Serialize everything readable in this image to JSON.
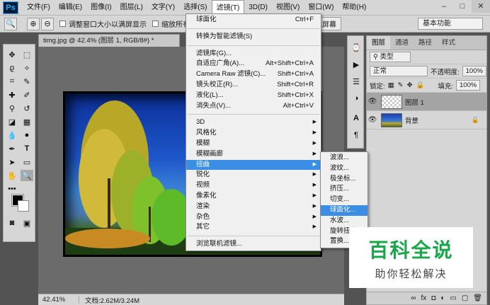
{
  "menubar": {
    "logo": "Ps",
    "items": [
      "文件(F)",
      "编辑(E)",
      "图像(I)",
      "图层(L)",
      "文字(Y)",
      "选择(S)",
      "滤镜(T)",
      "3D(D)",
      "视图(V)",
      "窗口(W)",
      "帮助(H)"
    ],
    "active_index": 6,
    "window_controls": [
      "–",
      "□",
      "✕"
    ]
  },
  "options_bar": {
    "check1": "调整窗口大小以满屏显示",
    "check2": "缩放所有",
    "button": "填充屏幕",
    "workspace": "基本功能"
  },
  "document": {
    "tab_title": "timg.jpg @ 42.4% (图层 1, RGB/8#) *",
    "zoom": "42.41%",
    "doc_size": "文档:2.62M/3.24M"
  },
  "filter_menu": {
    "items": [
      {
        "label": "球面化",
        "shortcut": "Ctrl+F"
      },
      {
        "sep": true
      },
      {
        "label": "转换为智能滤镜(S)"
      },
      {
        "sep": true
      },
      {
        "label": "滤镜库(G)..."
      },
      {
        "label": "自适应广角(A)...",
        "shortcut": "Alt+Shift+Ctrl+A"
      },
      {
        "label": "Camera Raw 滤镜(C)...",
        "shortcut": "Shift+Ctrl+A"
      },
      {
        "label": "镜头校正(R)...",
        "shortcut": "Shift+Ctrl+R"
      },
      {
        "label": "液化(L)...",
        "shortcut": "Shift+Ctrl+X"
      },
      {
        "label": "消失点(V)...",
        "shortcut": "Alt+Ctrl+V"
      },
      {
        "sep": true
      },
      {
        "label": "3D",
        "submenu": true
      },
      {
        "label": "风格化",
        "submenu": true
      },
      {
        "label": "模糊",
        "submenu": true
      },
      {
        "label": "模糊画廊",
        "submenu": true
      },
      {
        "label": "扭曲",
        "submenu": true,
        "highlighted": true
      },
      {
        "label": "锐化",
        "submenu": true
      },
      {
        "label": "视频",
        "submenu": true
      },
      {
        "label": "像素化",
        "submenu": true
      },
      {
        "label": "渲染",
        "submenu": true
      },
      {
        "label": "杂色",
        "submenu": true
      },
      {
        "label": "其它",
        "submenu": true
      },
      {
        "sep": true
      },
      {
        "label": "浏览联机滤镜..."
      }
    ]
  },
  "distort_menu": {
    "items": [
      {
        "label": "波浪..."
      },
      {
        "label": "波纹..."
      },
      {
        "label": "极坐标..."
      },
      {
        "label": "挤压..."
      },
      {
        "label": "切变..."
      },
      {
        "label": "球面化...",
        "highlighted": true
      },
      {
        "label": "水波..."
      },
      {
        "label": "旋转扭曲..."
      },
      {
        "label": "置换..."
      }
    ]
  },
  "layers_panel": {
    "tabs": [
      "图层",
      "通道",
      "路径",
      "样式"
    ],
    "kind_filter": "类型",
    "blend_mode": "正常",
    "opacity_label": "不透明度:",
    "opacity_value": "100%",
    "lock_label": "锁定:",
    "fill_label": "填充:",
    "fill_value": "100%",
    "layers": [
      {
        "name": "图层 1",
        "selected": true
      },
      {
        "name": "背景",
        "locked": true
      }
    ],
    "footer_icons": [
      "∞",
      "fx",
      "◘",
      "◐",
      "▭",
      "▢",
      "🗑"
    ]
  },
  "watermark": {
    "title": "百科全说",
    "subtitle": "助你轻松解决"
  }
}
